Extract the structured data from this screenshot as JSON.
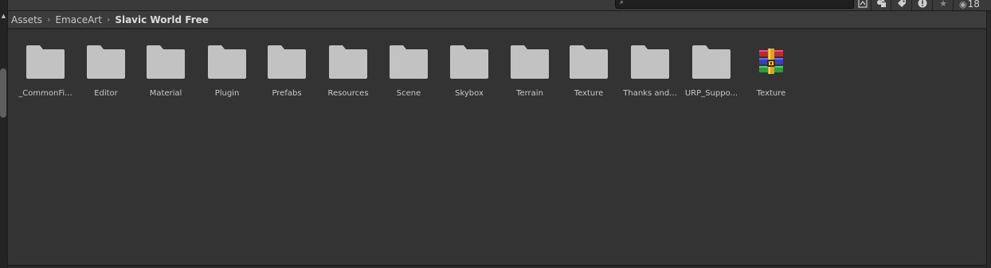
{
  "search": {
    "placeholder": "",
    "value": ""
  },
  "toolbar": {
    "icons": [
      "search-icon",
      "scene-type-filter-icon",
      "object-type-filter-icon",
      "label-filter-icon",
      "error-filter-icon",
      "favorite-icon",
      "visibility-icon"
    ],
    "hidden_count": "18"
  },
  "breadcrumb": {
    "items": [
      "Assets",
      "EmaceArt",
      "Slavic World Free"
    ]
  },
  "assets": [
    {
      "label": "_CommonFi...",
      "type": "folder"
    },
    {
      "label": "Editor",
      "type": "folder"
    },
    {
      "label": "Material",
      "type": "folder"
    },
    {
      "label": "Plugin",
      "type": "folder"
    },
    {
      "label": "Prefabs",
      "type": "folder"
    },
    {
      "label": "Resources",
      "type": "folder"
    },
    {
      "label": "Scene",
      "type": "folder"
    },
    {
      "label": "Skybox",
      "type": "folder"
    },
    {
      "label": "Terrain",
      "type": "folder"
    },
    {
      "label": "Texture",
      "type": "folder"
    },
    {
      "label": "Thanks and...",
      "type": "folder"
    },
    {
      "label": "URP_Suppo...",
      "type": "folder"
    },
    {
      "label": "Texture",
      "type": "archive"
    }
  ],
  "colors": {
    "folder": "#c2c2c2",
    "panel_bg": "#333333",
    "breadcrumb_bg": "#3c3c3c",
    "text": "#c8c8c8"
  }
}
